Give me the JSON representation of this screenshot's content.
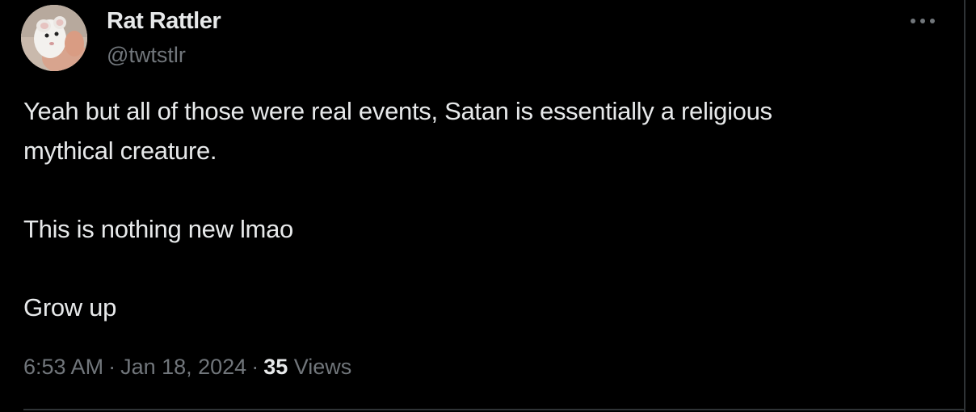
{
  "author": {
    "display_name": "Rat Rattler",
    "handle": "@twtstlr",
    "avatar_icon": "user-avatar"
  },
  "tweet": {
    "paragraphs": [
      "Yeah but all of those were real events, Satan is essentially a religious",
      "mythical creature.",
      "This is nothing new lmao",
      "Grow up"
    ],
    "time": "6:53 AM",
    "date": "Jan 18, 2024",
    "separator": "·",
    "views_count": "35",
    "views_label": "Views"
  },
  "more_menu": {
    "icon": "more-horizontal-icon"
  },
  "colors": {
    "background": "#000000",
    "text_primary": "#e7e9ea",
    "text_secondary": "#71767b",
    "border": "#2f3336"
  }
}
